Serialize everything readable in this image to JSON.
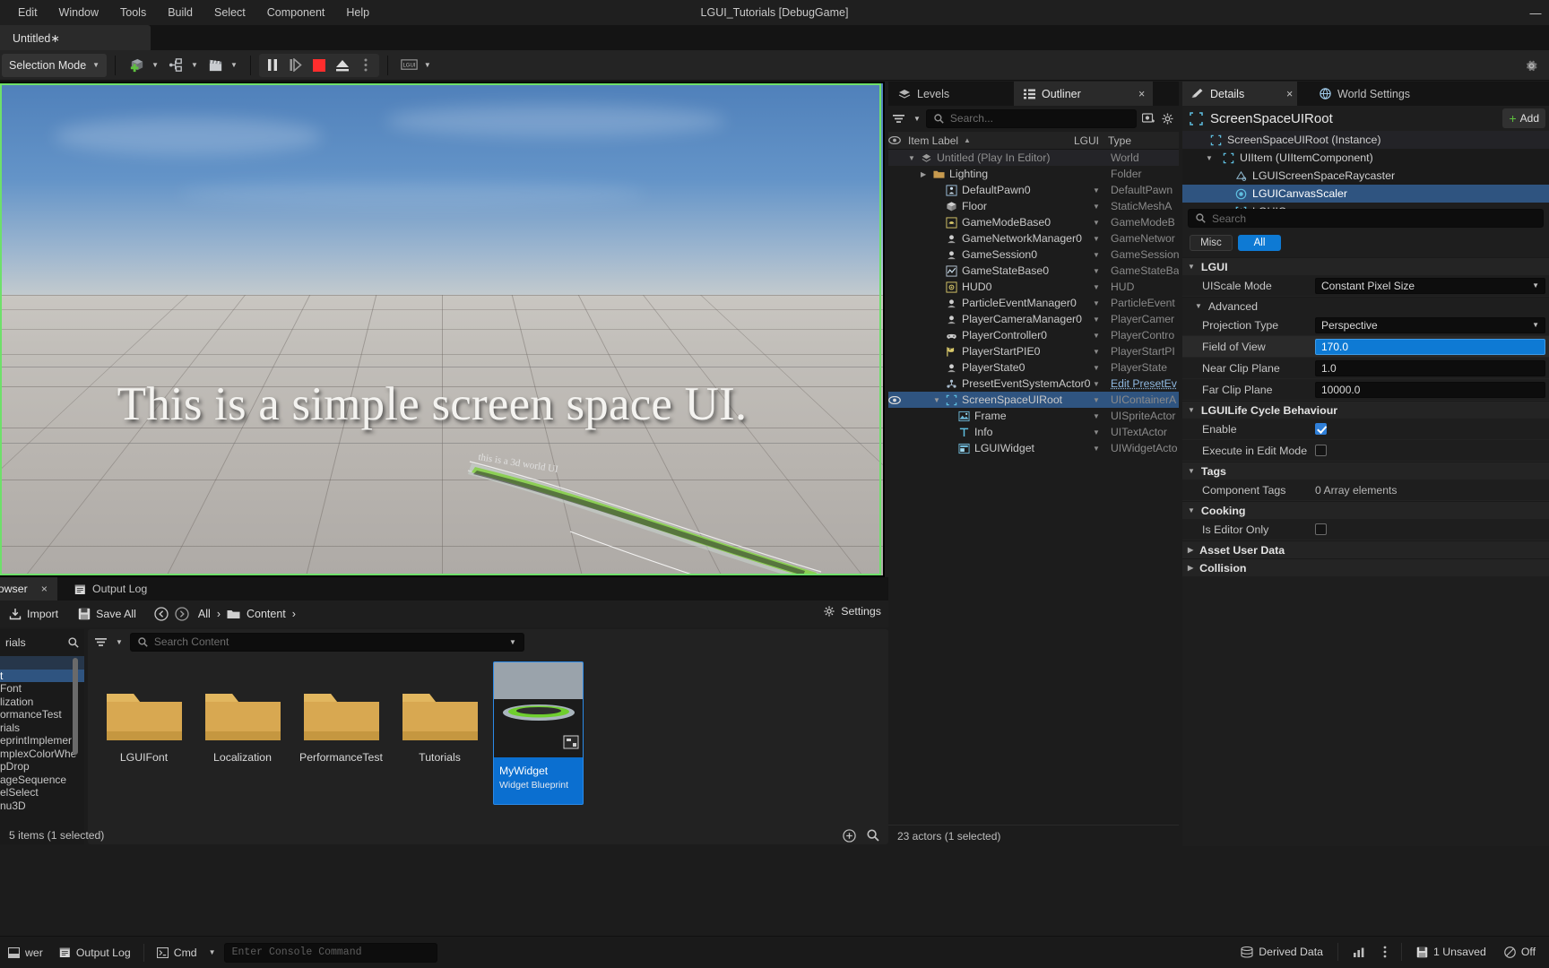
{
  "window": {
    "title": "LGUI_Tutorials [DebugGame]",
    "minimize": "—"
  },
  "menu": {
    "items": [
      {
        "label": "Edit"
      },
      {
        "label": "Window"
      },
      {
        "label": "Tools"
      },
      {
        "label": "Build"
      },
      {
        "label": "Select"
      },
      {
        "label": "Component"
      },
      {
        "label": "Help"
      }
    ]
  },
  "level_tab": {
    "label": "Untitled∗"
  },
  "toolbar": {
    "selection_mode": "Selection Mode",
    "lgui_badge": "LGUI"
  },
  "viewport": {
    "main_text": "This is a simple screen space UI.",
    "mini_text": "this is a 3d world UI"
  },
  "outliner": {
    "tabs": [
      {
        "label": "Levels",
        "icon": "levels-icon",
        "active": false
      },
      {
        "label": "Outliner",
        "icon": "outliner-icon",
        "active": true
      }
    ],
    "close_label": "×",
    "search_placeholder": "Search...",
    "columns": [
      "Item Label",
      "LGUI",
      "Type"
    ],
    "sort_indicator": "▲",
    "rows": [
      {
        "label": "Untitled (Play In Editor)",
        "type": "World",
        "icon": "world-icon",
        "depth": 0,
        "expander": "▼",
        "eye": false,
        "selected": false,
        "world": true,
        "chevron": false
      },
      {
        "label": "Lighting",
        "type": "Folder",
        "icon": "folder-icon",
        "depth": 1,
        "expander": "▶",
        "eye": false,
        "selected": false,
        "chevron": false
      },
      {
        "label": "DefaultPawn0",
        "type": "DefaultPawn",
        "icon": "pawn-icon",
        "depth": 2,
        "eye": false,
        "selected": false,
        "chevron": true
      },
      {
        "label": "Floor",
        "type": "StaticMeshA",
        "icon": "mesh-icon",
        "depth": 2,
        "eye": false,
        "selected": false,
        "chevron": true
      },
      {
        "label": "GameModeBase0",
        "type": "GameModeB",
        "icon": "gamemode-icon",
        "depth": 2,
        "eye": false,
        "selected": false,
        "chevron": true
      },
      {
        "label": "GameNetworkManager0",
        "type": "GameNetwor",
        "icon": "actor-icon",
        "depth": 2,
        "eye": false,
        "selected": false,
        "chevron": true
      },
      {
        "label": "GameSession0",
        "type": "GameSession",
        "icon": "actor-icon",
        "depth": 2,
        "eye": false,
        "selected": false,
        "chevron": true
      },
      {
        "label": "GameStateBase0",
        "type": "GameStateBa",
        "icon": "graph-icon",
        "depth": 2,
        "eye": false,
        "selected": false,
        "chevron": true
      },
      {
        "label": "HUD0",
        "type": "HUD",
        "icon": "hud-icon",
        "depth": 2,
        "eye": false,
        "selected": false,
        "chevron": true
      },
      {
        "label": "ParticleEventManager0",
        "type": "ParticleEvent",
        "icon": "actor-icon",
        "depth": 2,
        "eye": false,
        "selected": false,
        "chevron": true
      },
      {
        "label": "PlayerCameraManager0",
        "type": "PlayerCamer",
        "icon": "actor-icon",
        "depth": 2,
        "eye": false,
        "selected": false,
        "chevron": true
      },
      {
        "label": "PlayerController0",
        "type": "PlayerContro",
        "icon": "controller-icon",
        "depth": 2,
        "eye": false,
        "selected": false,
        "chevron": true
      },
      {
        "label": "PlayerStartPIE0",
        "type": "PlayerStartPI",
        "icon": "playerstart-icon",
        "depth": 2,
        "eye": false,
        "selected": false,
        "chevron": true
      },
      {
        "label": "PlayerState0",
        "type": "PlayerState",
        "icon": "actor-icon",
        "depth": 2,
        "eye": false,
        "selected": false,
        "chevron": true
      },
      {
        "label": "PresetEventSystemActor0",
        "type": "Edit PresetEv",
        "icon": "preset-icon",
        "depth": 2,
        "eye": false,
        "selected": false,
        "chevron": true,
        "link": true
      },
      {
        "label": "ScreenSpaceUIRoot",
        "type": "UIContainerA",
        "icon": "uiitem-icon",
        "depth": 2,
        "expander": "▼",
        "eye": true,
        "selected": true,
        "chevron": true
      },
      {
        "label": "Frame",
        "type": "UISpriteActor",
        "icon": "sprite-icon",
        "depth": 3,
        "eye": false,
        "selected": false,
        "chevron": true
      },
      {
        "label": "Info",
        "type": "UITextActor",
        "icon": "text-icon",
        "depth": 3,
        "eye": false,
        "selected": false,
        "chevron": true
      },
      {
        "label": "LGUIWidget",
        "type": "UIWidgetActo",
        "icon": "widget-icon",
        "depth": 3,
        "eye": false,
        "selected": false,
        "chevron": true
      }
    ],
    "footer": "23 actors (1 selected)"
  },
  "details": {
    "tabs": [
      {
        "label": "Details",
        "icon": "details-icon",
        "active": true
      },
      {
        "label": "World Settings",
        "icon": "worldsettings-icon",
        "active": false
      }
    ],
    "close_label": "×",
    "title": "ScreenSpaceUIRoot",
    "add_label": "Add",
    "add_plus": "+",
    "components": [
      {
        "label": "ScreenSpaceUIRoot (Instance)",
        "icon": "uiitem-icon",
        "depth": 0,
        "selected": false,
        "header": true
      },
      {
        "label": "UIItem (UIItemComponent)",
        "icon": "uiitem-icon",
        "depth": 1,
        "selected": false,
        "expander": "▼"
      },
      {
        "label": "LGUIScreenSpaceRaycaster",
        "icon": "raycaster-icon",
        "depth": 2,
        "selected": false
      },
      {
        "label": "LGUICanvasScaler",
        "icon": "canvasscaler-icon",
        "depth": 2,
        "selected": true
      },
      {
        "label": "LGUICanvas",
        "icon": "canvas-icon",
        "depth": 2,
        "selected": false
      }
    ],
    "search_placeholder": "Search",
    "filters": [
      {
        "label": "Misc",
        "active": false
      },
      {
        "label": "All",
        "active": true
      }
    ],
    "sections": [
      {
        "name": "LGUI",
        "collapsed": false,
        "rows": [
          {
            "name": "UIScale Mode",
            "value": "Constant Pixel Size",
            "kind": "dropdown"
          }
        ]
      },
      {
        "name": "Advanced",
        "sub": true,
        "collapsed": false,
        "rows": [
          {
            "name": "Projection Type",
            "value": "Perspective",
            "kind": "dropdown"
          },
          {
            "name": "Field of View",
            "value": "170.0",
            "kind": "number-selected",
            "highlight": true
          },
          {
            "name": "Near Clip Plane",
            "value": "1.0",
            "kind": "number"
          },
          {
            "name": "Far Clip Plane",
            "value": "10000.0",
            "kind": "number"
          }
        ]
      },
      {
        "name": "LGUILife Cycle Behaviour",
        "collapsed": false,
        "rows": [
          {
            "name": "Enable",
            "value": true,
            "kind": "checkbox"
          },
          {
            "name": "Execute in Edit Mode",
            "value": false,
            "kind": "checkbox"
          }
        ]
      },
      {
        "name": "Tags",
        "collapsed": false,
        "rows": [
          {
            "name": "Component Tags",
            "value": "0 Array elements",
            "kind": "text"
          }
        ]
      },
      {
        "name": "Cooking",
        "collapsed": false,
        "rows": [
          {
            "name": "Is Editor Only",
            "value": false,
            "kind": "checkbox"
          }
        ]
      },
      {
        "name": "Asset User Data",
        "collapsed": true,
        "rows": []
      },
      {
        "name": "Collision",
        "collapsed": true,
        "rows": []
      }
    ]
  },
  "content_browser": {
    "tabs": [
      {
        "label": "Content Browser",
        "short": "owser",
        "active": true,
        "closable": true
      },
      {
        "label": "Output Log",
        "active": false,
        "icon": "log-icon"
      }
    ],
    "import_label": "Import",
    "save_all_label": "Save All",
    "settings_label": "Settings",
    "breadcrumb": [
      "All",
      "Content"
    ],
    "breadcrumb_sep": "›",
    "sources_title": "rials",
    "sources": [
      {
        "label": "",
        "selected": false,
        "hi": true
      },
      {
        "label": "t",
        "selected": true
      },
      {
        "label": "Font"
      },
      {
        "label": "lization"
      },
      {
        "label": "ormanceTest"
      },
      {
        "label": "rials"
      },
      {
        "label": "eprintImplemer"
      },
      {
        "label": "mplexColorWhe"
      },
      {
        "label": "pDrop"
      },
      {
        "label": "ageSequence"
      },
      {
        "label": "elSelect"
      },
      {
        "label": "nu3D"
      }
    ],
    "search_placeholder": "Search Content",
    "folders": [
      {
        "label": "LGUIFont"
      },
      {
        "label": "Localization"
      },
      {
        "label": "PerformanceTest"
      },
      {
        "label": "Tutorials"
      }
    ],
    "asset": {
      "name": "MyWidget",
      "type": "Widget Blueprint"
    },
    "footer": "5 items (1 selected)"
  },
  "status_bar": {
    "drawer_label": "wer",
    "output_log": "Output Log",
    "cmd_label": "Cmd",
    "console_placeholder": "Enter Console Command",
    "derived_data": "Derived Data",
    "unsaved": "1 Unsaved",
    "unsaved_count": "1",
    "source_control": "Off"
  },
  "colors": {
    "accent_blue": "#0e7ad4",
    "selection_blue": "#2f5480",
    "viewport_green": "#6ee06a",
    "folder_tan": "#d8a851",
    "stop_red": "#ff2d2d"
  }
}
